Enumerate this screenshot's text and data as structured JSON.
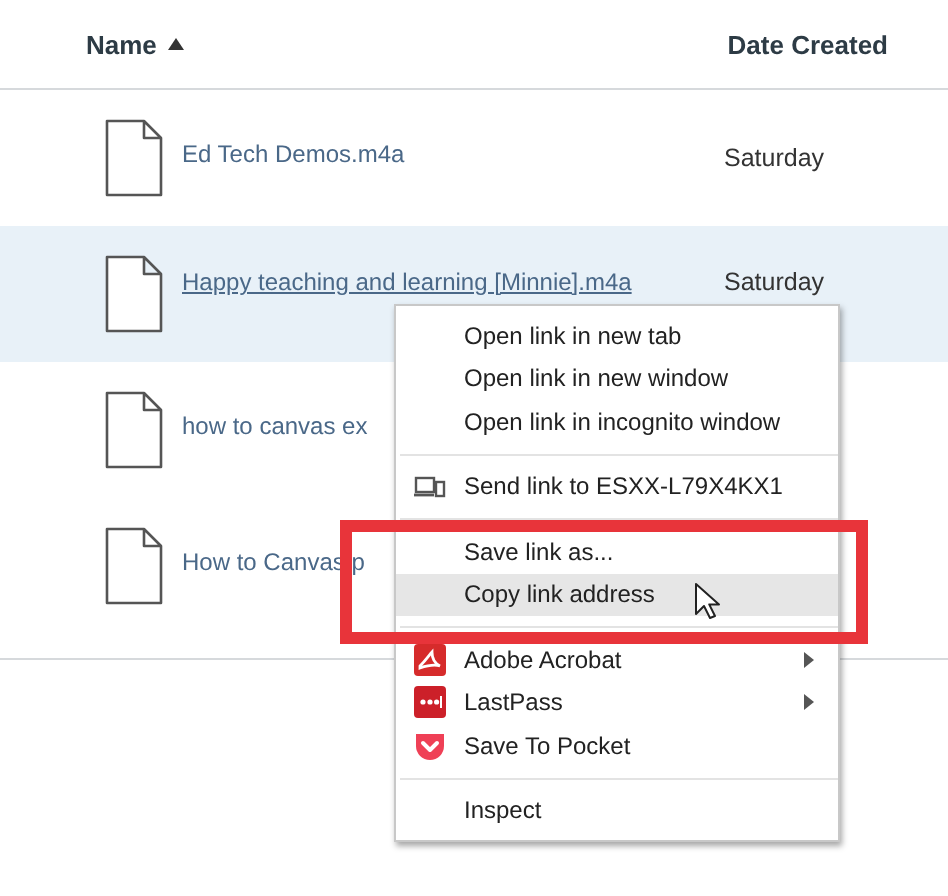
{
  "table": {
    "columns": [
      {
        "label": "Name",
        "sorted": true
      },
      {
        "label": "Date Created",
        "sorted": false
      }
    ],
    "rows": [
      {
        "name": "Ed Tech Demos.m4a",
        "date": "Saturday",
        "selected": false,
        "hovered": false
      },
      {
        "name": "Happy teaching and learning [Minnie].m4a",
        "date": "Saturday",
        "selected": true,
        "hovered": true
      },
      {
        "name": "how to canvas ex",
        "selected": false,
        "hovered": false
      },
      {
        "name": "How to Canvas p",
        "selected": false,
        "hovered": false
      }
    ]
  },
  "context_menu": {
    "items": [
      {
        "kind": "item",
        "label": "Open link in new tab",
        "highlighted": false
      },
      {
        "kind": "item",
        "label": "Open link in new window",
        "highlighted": false
      },
      {
        "kind": "item",
        "label": "Open link in incognito window",
        "highlighted": false
      },
      {
        "kind": "separator"
      },
      {
        "kind": "device",
        "label": "Send link to ESXX-L79X4KX1",
        "highlighted": false
      },
      {
        "kind": "separator"
      },
      {
        "kind": "item",
        "label": "Save link as...",
        "highlighted": false
      },
      {
        "kind": "item",
        "label": "Copy link address",
        "highlighted": true
      },
      {
        "kind": "separator"
      },
      {
        "kind": "acrobat",
        "label": "Adobe Acrobat",
        "highlighted": false,
        "submenu": true
      },
      {
        "kind": "lastpass",
        "label": "LastPass",
        "highlighted": false,
        "submenu": true
      },
      {
        "kind": "pocket",
        "label": "Save To Pocket",
        "highlighted": false
      },
      {
        "kind": "separator"
      },
      {
        "kind": "item",
        "label": "Inspect",
        "highlighted": false
      }
    ]
  },
  "annotation": {
    "kind": "highlight-box",
    "color": "#e8343a"
  }
}
